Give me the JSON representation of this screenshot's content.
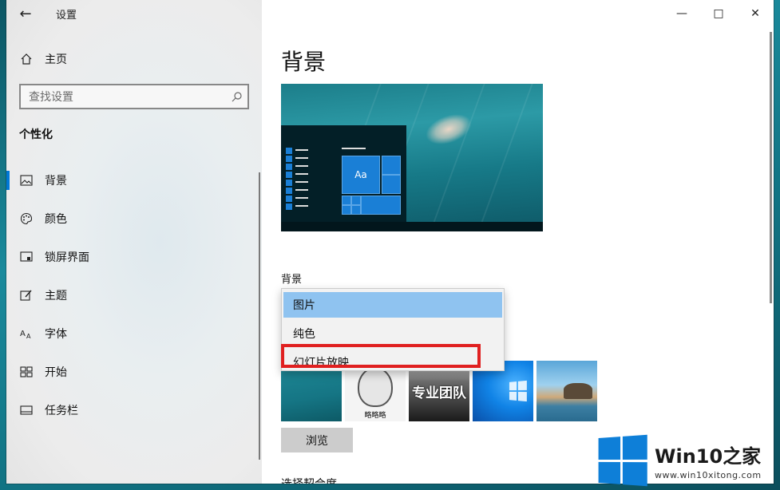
{
  "app": {
    "title": "设置"
  },
  "sidebar": {
    "home_label": "主页",
    "search_placeholder": "查找设置",
    "section_title": "个性化",
    "items": [
      {
        "label": "背景",
        "icon": "picture-icon",
        "active": true
      },
      {
        "label": "颜色",
        "icon": "palette-icon",
        "active": false
      },
      {
        "label": "锁屏界面",
        "icon": "lock-screen-icon",
        "active": false
      },
      {
        "label": "主题",
        "icon": "theme-icon",
        "active": false
      },
      {
        "label": "字体",
        "icon": "font-icon",
        "active": false
      },
      {
        "label": "开始",
        "icon": "start-icon",
        "active": false
      },
      {
        "label": "任务栏",
        "icon": "taskbar-icon",
        "active": false
      }
    ]
  },
  "main": {
    "page_title": "背景",
    "preview_tile_label": "Aa",
    "background_label": "背景",
    "dropdown_options": [
      "图片",
      "纯色",
      "幻灯片放映"
    ],
    "selected_option": "图片",
    "thumbnails": [
      {
        "name": "underwater",
        "caption": ""
      },
      {
        "name": "meme-face",
        "caption": "略略略"
      },
      {
        "name": "pro-team",
        "caption": "专业团队"
      },
      {
        "name": "windows-blue",
        "caption": ""
      },
      {
        "name": "beach-rocks",
        "caption": ""
      }
    ],
    "browse_label": "浏览",
    "fit_label": "选择契合度"
  },
  "watermark": {
    "brand": "Win10",
    "brand_suffix": "之家",
    "url": "www.win10xitong.com"
  },
  "colors": {
    "accent": "#0078d7",
    "highlight_box": "#e02020",
    "dropdown_selected": "#8fc3f0"
  }
}
